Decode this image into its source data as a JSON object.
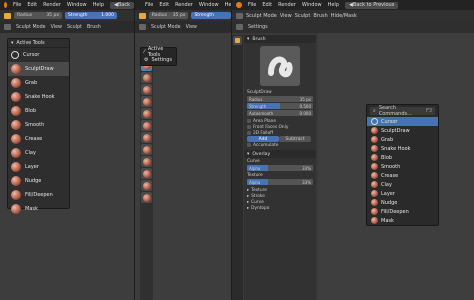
{
  "menubar": {
    "items": [
      "File",
      "Edit",
      "Render",
      "Window",
      "Help"
    ],
    "back_label": "Back",
    "back_to_previous": "Back to Previous"
  },
  "header": {
    "radius_label": "Radius",
    "radius_value": "35 px",
    "strength_label": "Strength",
    "strength_value": "1.000"
  },
  "mode_bar": {
    "mode": "Sculpt Mode",
    "items": [
      "View",
      "Sculpt",
      "Brush",
      "Hide/Mask"
    ]
  },
  "active_tools_panel": {
    "title": "Active Tools",
    "tools": [
      "Cursor",
      "SculptDraw",
      "Grab",
      "Snake Hook",
      "Blob",
      "Smooth",
      "Crease",
      "Clay",
      "Layer",
      "Nudge",
      "Fill/Deepen",
      "Mask"
    ],
    "active_index": 1
  },
  "popup_menu": {
    "items": [
      "Active Tools",
      "Settings"
    ]
  },
  "properties": {
    "title": "Settings",
    "brush_section": "Brush",
    "brush_name": "SculptDraw",
    "radius_label": "Radius",
    "radius_value": "35 px",
    "strength_label": "Strength",
    "strength_value": "0.500",
    "autosmooth_label": "Autosmooth",
    "autosmooth_value": "0.000",
    "plane_label": "Area Plane",
    "checks": [
      "Front Faces Only",
      "2D Falloff",
      "Accumulate"
    ],
    "add_label": "Add",
    "subtract_label": "Subtract",
    "overlay_section": "Overlay",
    "curve_label": "Curve",
    "texture_label": "Texture",
    "alpha_label": "Alpha",
    "alpha_value_1": "33%",
    "alpha_value_2": "33%",
    "subsections": [
      "Texture",
      "Stroke",
      "Curve",
      "Dyntopo"
    ]
  },
  "search_menu": {
    "placeholder": "Search Commands...",
    "shortcut": "F3",
    "items": [
      "Cursor",
      "SculptDraw",
      "Grab",
      "Snake Hook",
      "Blob",
      "Smooth",
      "Crease",
      "Clay",
      "Layer",
      "Nudge",
      "Fill/Deepen",
      "Mask"
    ],
    "active_index": 0
  },
  "colors": {
    "accent_blue": "#4772b3",
    "logo_orange": "#e87d0d"
  }
}
